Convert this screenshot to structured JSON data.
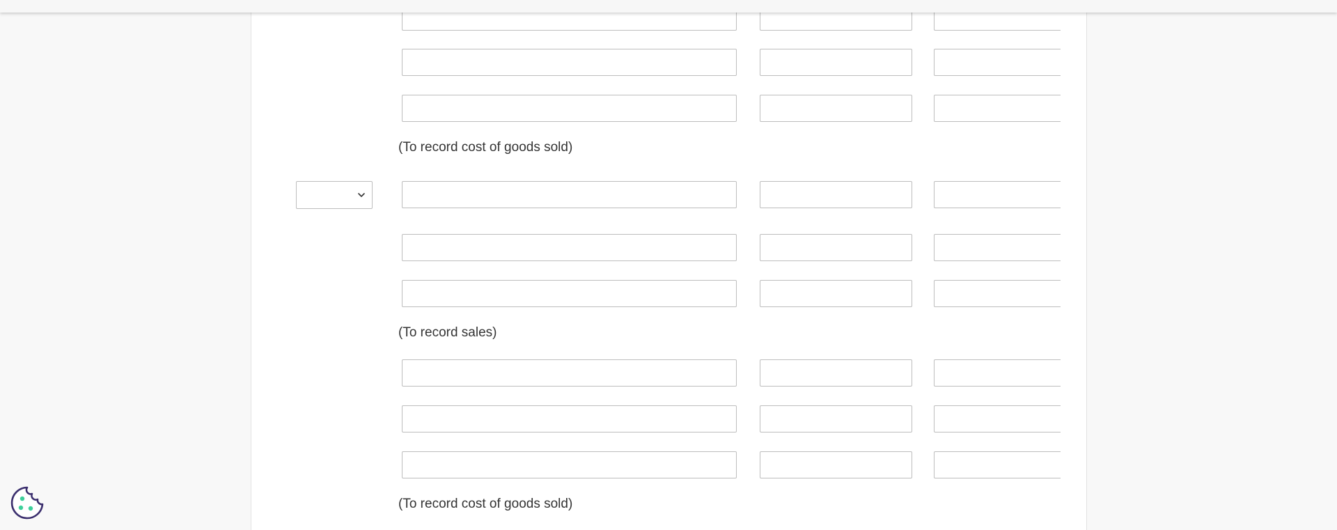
{
  "journal": {
    "groups": [
      {
        "memo": "(To record cost of goods sold)"
      },
      {
        "memo": "(To record sales)"
      },
      {
        "memo": "(To record cost of goods sold)"
      }
    ],
    "date_select": {
      "value": ""
    }
  },
  "icons": {
    "cookie": "cookie-icon",
    "chevron": "chevron-down-icon"
  },
  "colors": {
    "page_background": "#f8f8f8",
    "card_background": "#ffffff",
    "field_border": "#bdbdbd",
    "text": "#333333",
    "cookie_stroke": "#3b2f6e",
    "cookie_dots": "#3ecf9a"
  }
}
